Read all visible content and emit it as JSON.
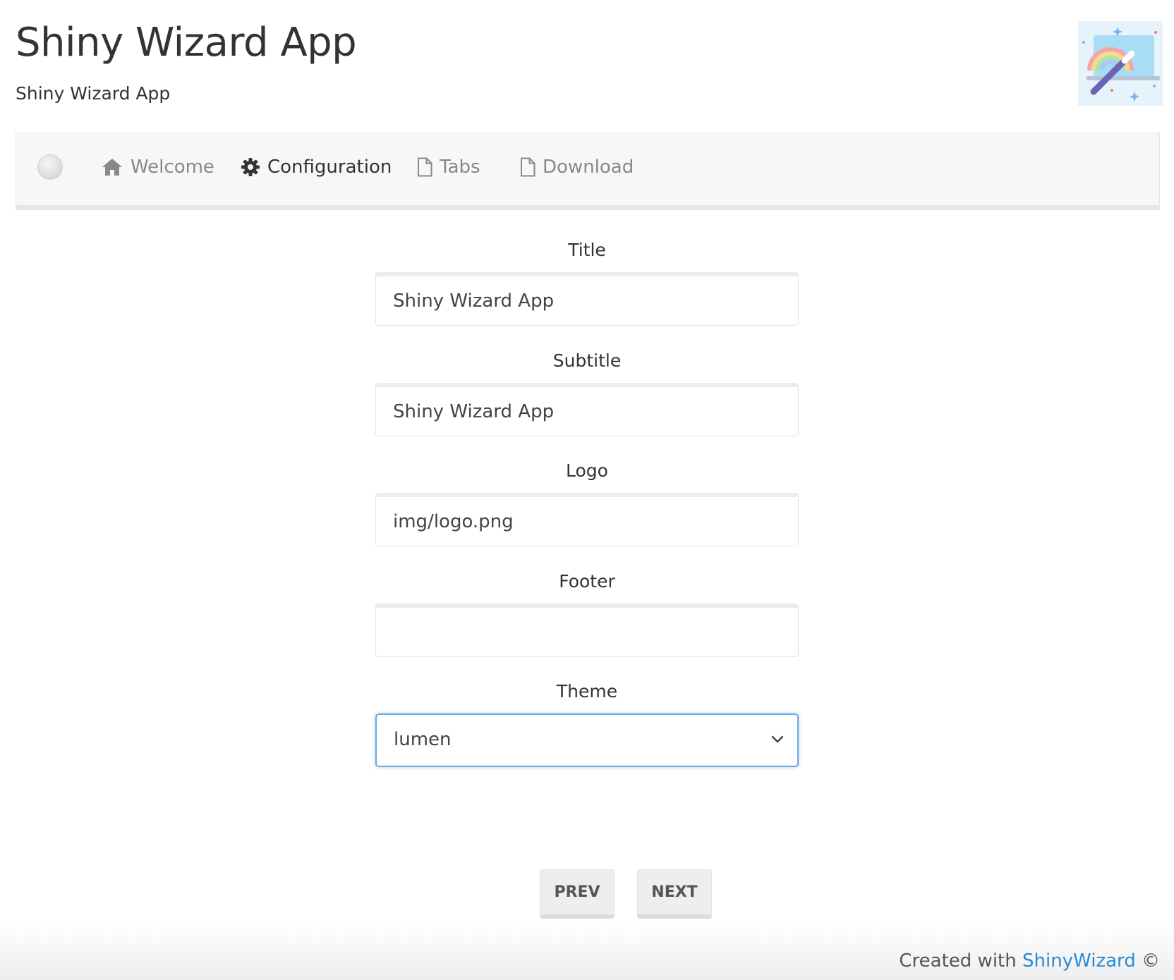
{
  "header": {
    "title": "Shiny Wizard App",
    "subtitle": "Shiny Wizard App",
    "logo_icon": "rainbow-wand-logo"
  },
  "nav": {
    "items": [
      {
        "label": "Welcome",
        "icon": "home-icon",
        "active": false
      },
      {
        "label": "Configuration",
        "icon": "gear-icon",
        "active": true
      },
      {
        "label": "Tabs",
        "icon": "file-icon",
        "active": false
      },
      {
        "label": "Download",
        "icon": "file-icon",
        "active": false
      }
    ]
  },
  "form": {
    "title": {
      "label": "Title",
      "value": "Shiny Wizard App"
    },
    "subtitle": {
      "label": "Subtitle",
      "value": "Shiny Wizard App"
    },
    "logo": {
      "label": "Logo",
      "value": "img/logo.png"
    },
    "footer": {
      "label": "Footer",
      "value": ""
    },
    "theme": {
      "label": "Theme",
      "value": "lumen"
    }
  },
  "buttons": {
    "prev": "PREV",
    "next": "NEXT"
  },
  "footer": {
    "prefix": "Created with ",
    "link": "ShinyWizard",
    "suffix": " ©"
  },
  "colors": {
    "link": "#2a8bd4",
    "focus": "#6aa8e0",
    "navbar_bg": "#f7f7f7"
  }
}
